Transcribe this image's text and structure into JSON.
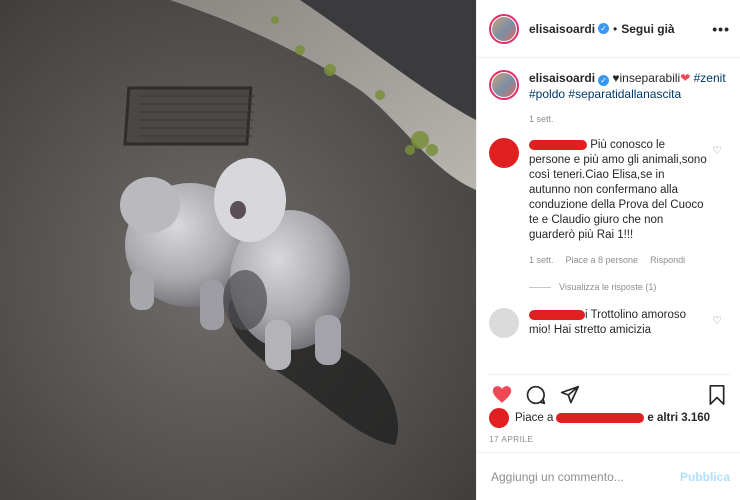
{
  "post": {
    "username": "elisaisoardi",
    "follow_separator": "•",
    "follow_label": "Segui già",
    "more_label": "•••"
  },
  "caption": {
    "username": "elisaisoardi",
    "text_prefix": "♥inseparabili",
    "heart": "❤",
    "tag1": "#zenit",
    "tag2": "#poldo",
    "tag3": "#separatidallanascita",
    "time": "1 sett."
  },
  "comment1": {
    "text": "Più conosco le persone e più amo gli animali,sono così teneri.Ciao Elisa,se in autunno non confermano alla conduzione della Prova del Cuoco te e Claudio giuro che non guarderò più Rai 1!!!",
    "time": "1 sett.",
    "likes": "Piace a 8 persone",
    "reply": "Rispondi",
    "view_replies": "Visualizza le risposte (1)"
  },
  "comment2": {
    "text_prefix": "i",
    "text": "Trottolino amoroso mio! Hai stretto amicizia"
  },
  "likes": {
    "prefix": "Piace a",
    "suffix": "e altri 3.160"
  },
  "date": "17 APRILE",
  "add_comment": {
    "placeholder": "Aggiungi un commento...",
    "publish_label": "Pubblica"
  },
  "colors": {
    "verified": "#3897f0",
    "redaction": "#e02020",
    "liked_heart": "#ed4956",
    "hashtag": "#00376b",
    "publish_disabled": "#b2dffc"
  }
}
